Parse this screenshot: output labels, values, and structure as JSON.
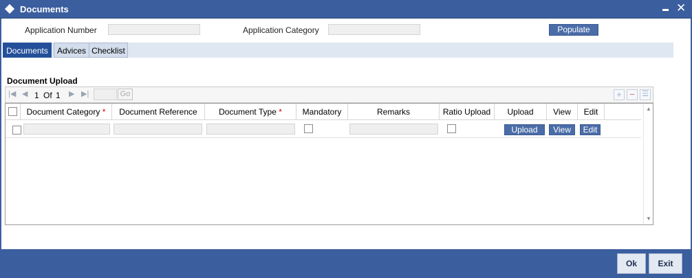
{
  "window": {
    "title": "Documents",
    "minimize_icon": "minimize-icon",
    "close_symbol": "✕"
  },
  "form": {
    "application_number_label": "Application Number",
    "application_number_value": "",
    "application_category_label": "Application Category",
    "application_category_value": "",
    "populate_label": "Populate"
  },
  "tabs": [
    {
      "label": "Documents",
      "active": true
    },
    {
      "label": "Advices",
      "active": false
    },
    {
      "label": "Checklist",
      "active": false
    }
  ],
  "section": {
    "title": "Document Upload"
  },
  "pagination": {
    "current": "1",
    "of_label": "Of",
    "total": "1",
    "go_label": "Go",
    "page_input": ""
  },
  "grid": {
    "columns": [
      {
        "label": "Document Category",
        "required": true
      },
      {
        "label": "Document Reference",
        "required": false
      },
      {
        "label": "Document Type",
        "required": true
      },
      {
        "label": "Mandatory",
        "required": false
      },
      {
        "label": "Remarks",
        "required": false
      },
      {
        "label": "Ratio Upload",
        "required": false
      },
      {
        "label": "Upload",
        "required": false
      },
      {
        "label": "View",
        "required": false
      },
      {
        "label": "Edit",
        "required": false
      }
    ],
    "required_marker": "*",
    "rows": [
      {
        "document_category": "",
        "document_reference": "",
        "document_type": "",
        "mandatory": false,
        "remarks": "",
        "ratio_upload": false,
        "upload_label": "Upload",
        "view_label": "View",
        "edit_label": "Edit"
      }
    ]
  },
  "footer": {
    "ok_label": "Ok",
    "exit_label": "Exit"
  },
  "colors": {
    "header_blue": "#3b5e9e",
    "button_blue": "#4b6da7",
    "active_tab": "#24509a"
  }
}
